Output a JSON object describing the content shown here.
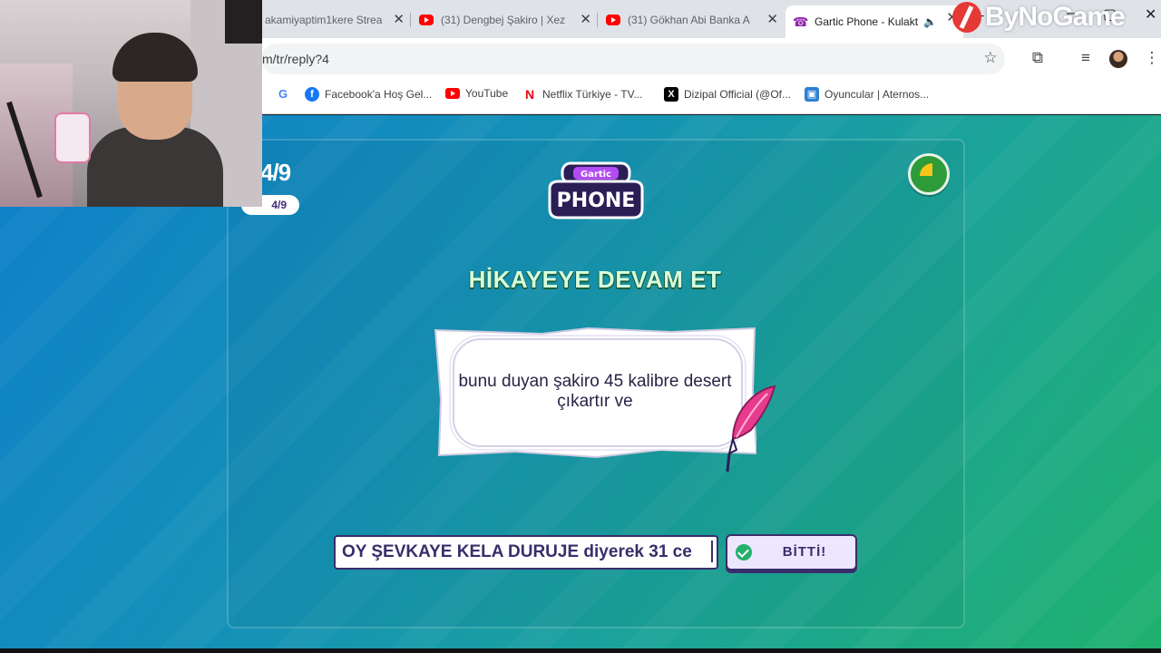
{
  "browser": {
    "tabs": [
      {
        "title": "akamiyaptim1kere Strea",
        "icon": "twitch-icon"
      },
      {
        "title": "(31) Dengbej Şakiro | Xez",
        "icon": "youtube-icon"
      },
      {
        "title": "(31) Gökhan Abi Banka A",
        "icon": "youtube-icon"
      },
      {
        "title": "Gartic Phone - Kulakt",
        "icon": "gartic-phone-icon",
        "active": true,
        "audio_icon": "speaker-icon"
      }
    ],
    "tab_close_glyph": "✕",
    "new_tab_glyph": "+",
    "url": "m/tr/reply?4",
    "bookmarks": [
      {
        "label": "",
        "icon": "google-icon"
      },
      {
        "label": "Facebook'a Hoş Gel...",
        "icon": "facebook-icon"
      },
      {
        "label": "YouTube",
        "icon": "youtube-icon"
      },
      {
        "label": "Netflix Türkiye - TV...",
        "icon": "netflix-icon"
      },
      {
        "label": "Dizipal Official (@Of...",
        "icon": "x-icon"
      },
      {
        "label": "Oyuncular | Aternos...",
        "icon": "aternos-icon"
      }
    ]
  },
  "game": {
    "round_big": "4/9",
    "round_pill": "4/9",
    "logo_line1": "Gartic",
    "logo_line2": "PHONE",
    "title": "HİKAYEYE DEVAM ET",
    "prompt_text": "bunu duyan şakiro 45 kalibre desert çıkartır ve",
    "answer_value": "OY ŞEVKAYE KELA DURUJE diyerek 31 ce",
    "done_label": "BİTTİ!",
    "timer_progress": 0.25
  },
  "overlay": {
    "watermark": "ByNoGame"
  },
  "colors": {
    "ink": "#3a2d6b",
    "title_green": "#d8ffdc",
    "done_bg": "#ede6ff",
    "check_green": "#25b06b",
    "timer_green": "#2e9b3a",
    "timer_hand": "#f5c518"
  }
}
